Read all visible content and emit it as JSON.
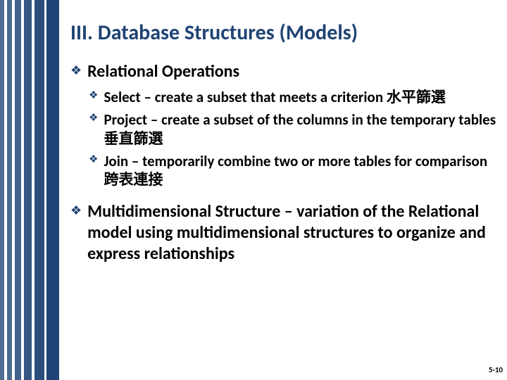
{
  "title": "III. Database Structures (Models)",
  "l1a": "Relational Operations",
  "l2a": "Select – create a subset that meets a criterion 水平篩選",
  "l2b": "Project – create a subset of the columns in the temporary tables 垂直篩選",
  "l2c": "Join – temporarily combine two or more tables for comparison 跨表連接",
  "l1b": "Multidimensional Structure – variation of the Relational model using multidimensional structures to organize and express relationships",
  "pagenum": "5-10",
  "bullet_glyph": "❖"
}
